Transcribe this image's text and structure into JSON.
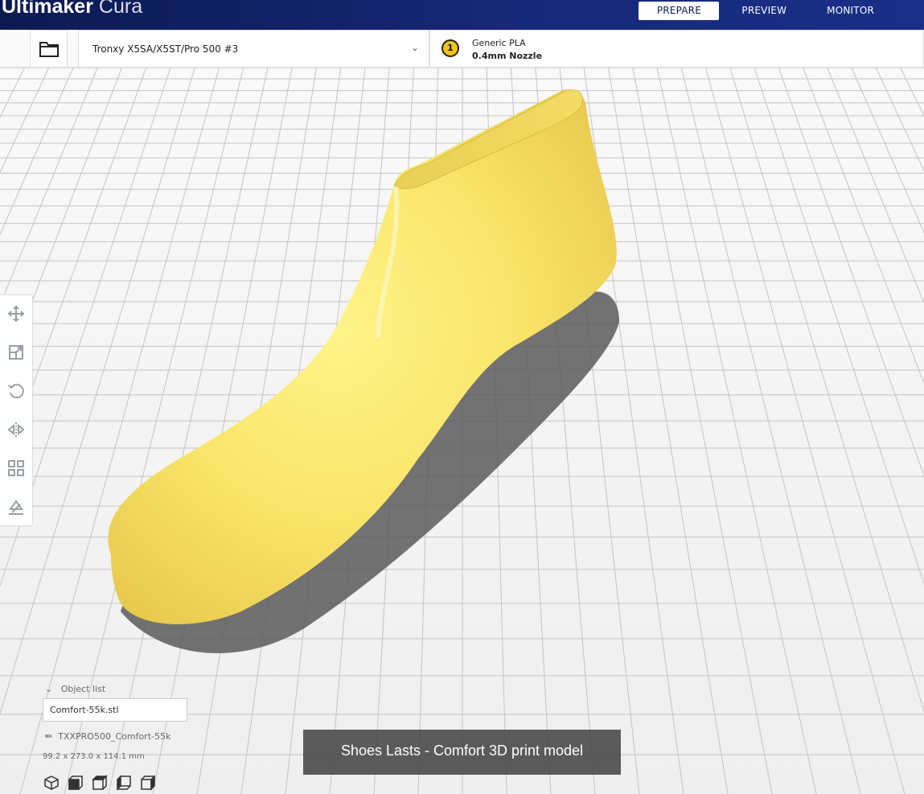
{
  "app": {
    "brand_bold": "Ultimaker",
    "brand_light": "Cura"
  },
  "stages": [
    {
      "label": "PREPARE",
      "active": true
    },
    {
      "label": "PREVIEW",
      "active": false
    },
    {
      "label": "MONITOR",
      "active": false
    }
  ],
  "printer": {
    "name": "Tronxy X5SA/X5ST/Pro 500 #3"
  },
  "extruder": {
    "index": "1",
    "material": "Generic PLA",
    "nozzle": "0.4mm Nozzle"
  },
  "tools": [
    "move-icon",
    "scale-icon",
    "rotate-icon",
    "mirror-icon",
    "per-model-settings-icon",
    "support-blocker-icon"
  ],
  "object_list": {
    "toggle_label": "Object list",
    "selected": "Comfort-55k.stl",
    "job_name": "TXXPRO500_Comfort-55k",
    "dimensions": "99.2 x 273.0 x 114.1 mm"
  },
  "views": [
    "3d-view-icon",
    "front-view-icon",
    "top-view-icon",
    "left-view-icon",
    "right-view-icon"
  ],
  "caption": "Shoes Lasts - Comfort 3D print model",
  "colors": {
    "accent": "#0c1a52",
    "model": "#f7e36a",
    "grid": "#c9c9c9"
  }
}
